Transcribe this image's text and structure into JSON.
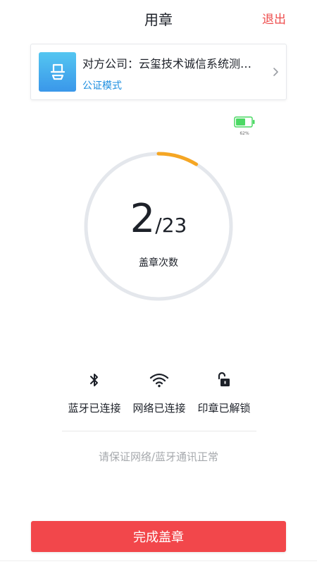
{
  "header": {
    "title": "用章",
    "exit_label": "退出"
  },
  "company": {
    "name": "对方公司：云玺技术诚信系统测试公司",
    "mode": "公证模式"
  },
  "battery": {
    "percent_label": "62%",
    "level": 0.62
  },
  "counter": {
    "current": "2",
    "total": "/23",
    "label": "盖章次数",
    "progress": 0.087
  },
  "status": [
    {
      "icon": "bluetooth-icon",
      "label": "蓝牙已连接"
    },
    {
      "icon": "wifi-icon",
      "label": "网络已连接"
    },
    {
      "icon": "unlock-icon",
      "label": "印章已解锁"
    }
  ],
  "notice": "请保证网络/蓝牙通讯正常",
  "actions": {
    "complete_label": "完成盖章"
  },
  "colors": {
    "accent_red": "#f2474b",
    "progress_orange": "#f5a623",
    "ring_gray": "#e4e7ec",
    "link_blue": "#1e8fe0",
    "battery_green": "#4cd964"
  }
}
